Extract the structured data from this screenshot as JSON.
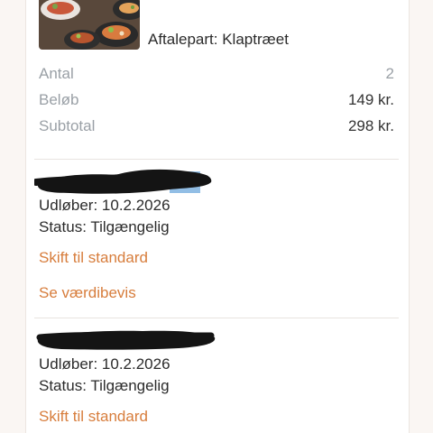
{
  "order": {
    "partner_label": "Aftalepart: Klaptræet",
    "quantity_label": "Antal",
    "quantity_value": "2",
    "amount_label": "Beløb",
    "amount_value": "149 kr.",
    "subtotal_label": "Subtotal",
    "subtotal_value": "298 kr.",
    "image_icon": "food-plates-photo"
  },
  "vouchers": [
    {
      "title": "",
      "expires": "Udløber: 10.2.2026",
      "status": "Status: Tilgængelig",
      "switch_label": "Skift til standard",
      "view_label": "Se værdibevis"
    },
    {
      "title": "",
      "expires": "Udløber: 10.2.2026",
      "status": "Status: Tilgængelig",
      "switch_label": "Skift til standard"
    }
  ],
  "colors": {
    "link": "#d77d3c",
    "label": "#9aa0a6",
    "text": "#2b2b2b",
    "background": "#faf6f3"
  }
}
